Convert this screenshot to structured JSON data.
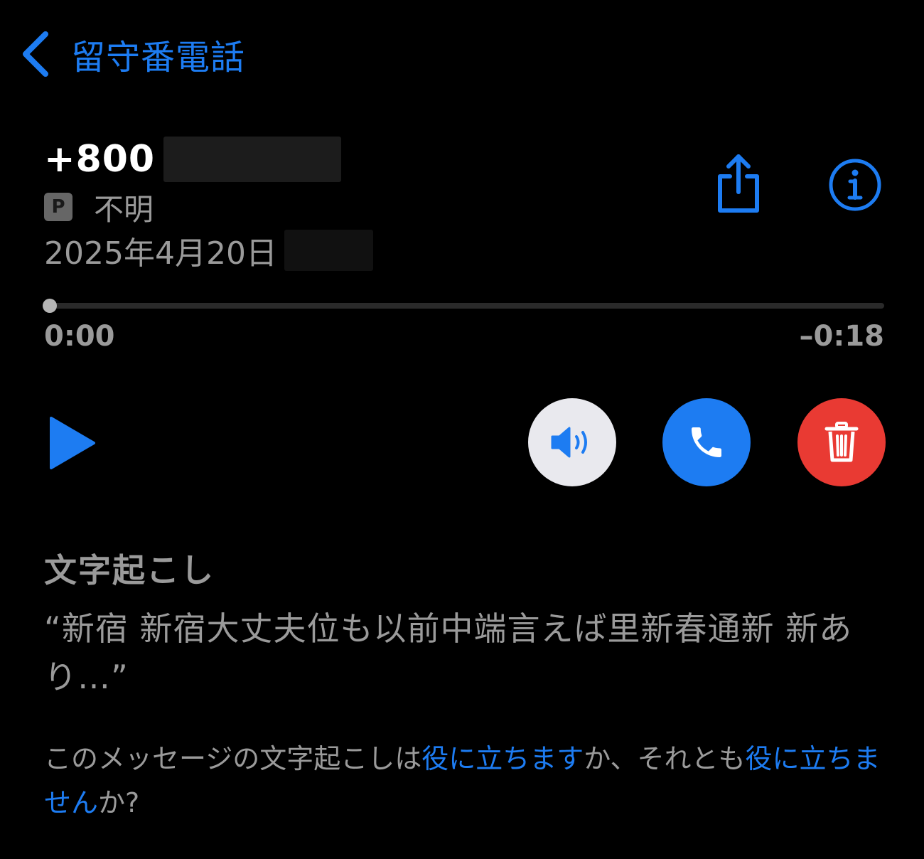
{
  "nav": {
    "back_label": "留守番電話"
  },
  "caller": {
    "number_prefix": "+800",
    "badge_letter": "P",
    "label": "不明",
    "date": "2025年4月20日"
  },
  "playback": {
    "progress": 0.0,
    "elapsed": "0:00",
    "remaining": "–0:18"
  },
  "transcript": {
    "heading": "文字起こし",
    "text": "“新宿 新宿大丈夫位も以前中端言えば里新春通新 新あり…”"
  },
  "feedback": {
    "prefix": "このメッセージの文字起こしは",
    "helpful_link": "役に立ちます",
    "middle": "か、それとも",
    "not_helpful_link": "役に立ちません",
    "suffix": "か?"
  },
  "colors": {
    "accent": "#1d7cf2",
    "delete": "#e93a33",
    "speaker_bg": "#e9e9ee",
    "secondary_text": "#9a9a9a"
  },
  "icons": {
    "back": "chevron-left-icon",
    "share": "share-icon",
    "info": "info-icon",
    "play": "play-icon",
    "speaker": "speaker-icon",
    "call": "phone-icon",
    "delete": "trash-icon"
  }
}
